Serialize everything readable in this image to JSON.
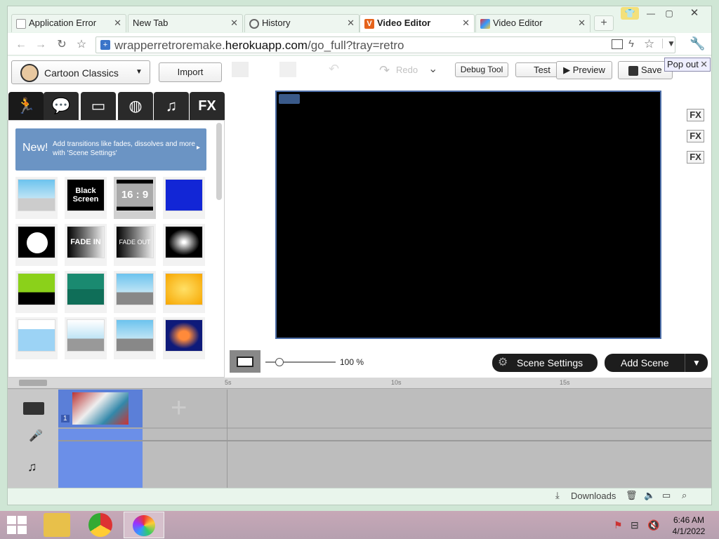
{
  "browser": {
    "tabs": [
      {
        "label": "Application Error"
      },
      {
        "label": "New Tab"
      },
      {
        "label": "History"
      },
      {
        "label": "Video Editor",
        "active": true
      },
      {
        "label": "Video Editor"
      }
    ],
    "new_tab_label": "+",
    "address": {
      "prefix": "wrapperretroremake.",
      "domain": "herokuapp.com",
      "path": "/go_full?tray=retro"
    }
  },
  "app": {
    "theme_selector": "Cartoon Classics",
    "import_label": "Import",
    "redo_label": "Redo",
    "debug_label": "Debug Tool",
    "test_label": "Test",
    "preview_label": "Preview",
    "save_label": "Save",
    "popout_label": "Pop out",
    "categories": [
      "character",
      "speech-bubble",
      "prop",
      "ball",
      "music",
      "FX"
    ],
    "fx_label": "FX",
    "banner": {
      "new": "New!",
      "text": "Add transitions like fades, dissolves and more with 'Scene Settings'"
    },
    "thumbs": [
      {
        "label": ""
      },
      {
        "label": "Black Screen"
      },
      {
        "label": "16 : 9"
      },
      {
        "label": ""
      },
      {
        "label": ""
      },
      {
        "label": "FADE IN"
      },
      {
        "label": "FADE OUT"
      },
      {
        "label": ""
      },
      {
        "label": ""
      },
      {
        "label": ""
      },
      {
        "label": ""
      },
      {
        "label": ""
      },
      {
        "label": ""
      },
      {
        "label": ""
      },
      {
        "label": ""
      },
      {
        "label": ""
      }
    ],
    "zoom": "100 %",
    "zoom_level": 0.2,
    "scene_settings_label": "Scene Settings",
    "add_scene_label": "Add Scene",
    "ruler_marks": [
      "5s",
      "10s",
      "15s"
    ],
    "scene_number": "1"
  },
  "statusbar": {
    "downloads": "Downloads"
  },
  "taskbar": {
    "time": "6:46 AM",
    "date": "4/1/2022"
  },
  "colors": {
    "accent_blue": "#6b94c4",
    "stage_border": "#4d6ea8",
    "timeline_selected": "#6b8fe8"
  }
}
